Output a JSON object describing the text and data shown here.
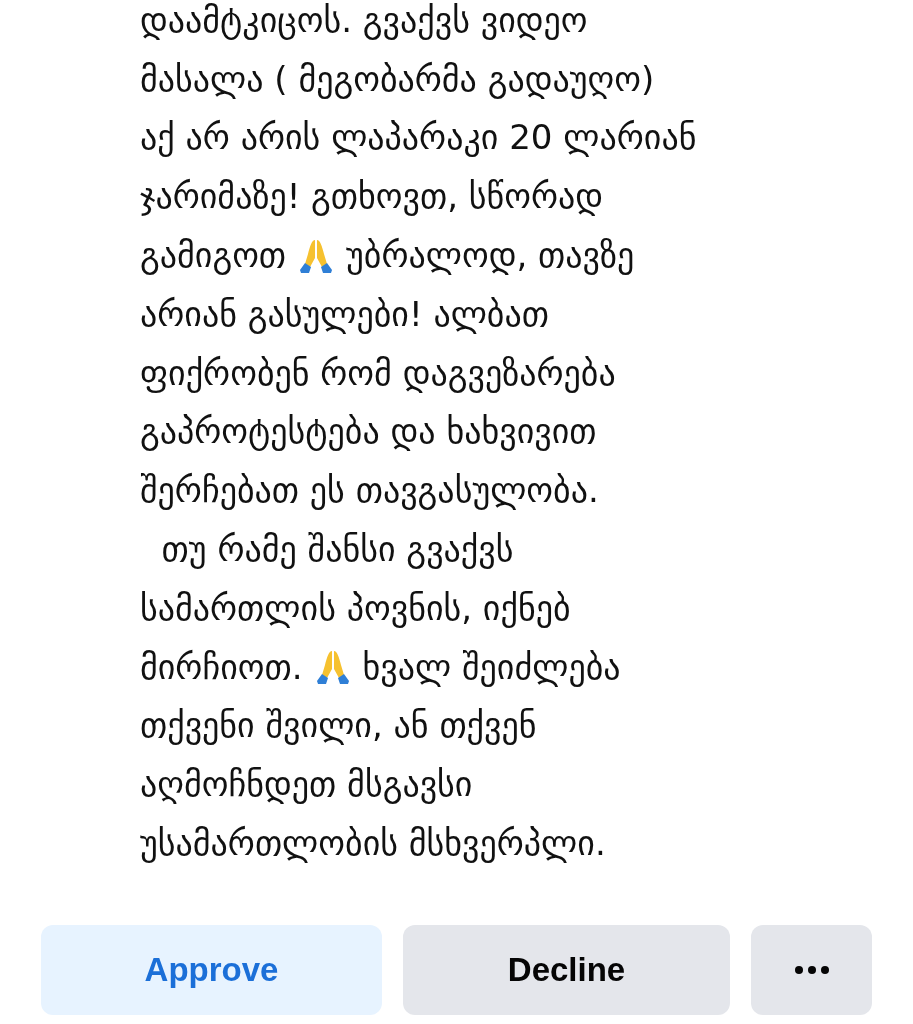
{
  "post": {
    "lines": [
      [
        {
          "kind": "text",
          "text": "დაამტკიცოს. გვაქვს ვიდეო"
        }
      ],
      [
        {
          "kind": "text",
          "text": "მასალა ( მეგობარმა გადაუღო)"
        }
      ],
      [
        {
          "kind": "text",
          "text": "აქ არ არის ლაპარაკი 20 ლარიან"
        }
      ],
      [
        {
          "kind": "text",
          "text": "ჯარიმაზე! გთხოვთ, სწორად"
        }
      ],
      [
        {
          "kind": "text",
          "text": "გამიგოთ"
        },
        {
          "kind": "emoji"
        },
        {
          "kind": "text",
          "text": "უბრალოდ, თავზე"
        }
      ],
      [
        {
          "kind": "text",
          "text": "არიან გასულები! ალბათ"
        }
      ],
      [
        {
          "kind": "text",
          "text": "ფიქრობენ რომ დაგვეზარება"
        }
      ],
      [
        {
          "kind": "text",
          "text": "გაპროტესტება და ხახვივით"
        }
      ],
      [
        {
          "kind": "text",
          "text": "შერჩებათ ეს თავგასულობა."
        }
      ],
      [
        {
          "kind": "text",
          "text": "  თუ რამე შანსი გვაქვს"
        }
      ],
      [
        {
          "kind": "text",
          "text": "სამართლის პოვნის, იქნებ"
        }
      ],
      [
        {
          "kind": "text",
          "text": "მირჩიოთ."
        },
        {
          "kind": "emoji"
        },
        {
          "kind": "text",
          "text": "ხვალ შეიძლება"
        }
      ],
      [
        {
          "kind": "text",
          "text": "თქვენი შვილი, ან თქვენ"
        }
      ],
      [
        {
          "kind": "text",
          "text": "აღმოჩნდეთ მსგავსი"
        }
      ],
      [
        {
          "kind": "text",
          "text": "უსამართლობის მსხვერპლი."
        }
      ]
    ]
  },
  "actions": [
    {
      "kind": "primary",
      "label": "Approve"
    },
    {
      "kind": "secondary",
      "label": "Decline"
    },
    {
      "kind": "more"
    }
  ]
}
